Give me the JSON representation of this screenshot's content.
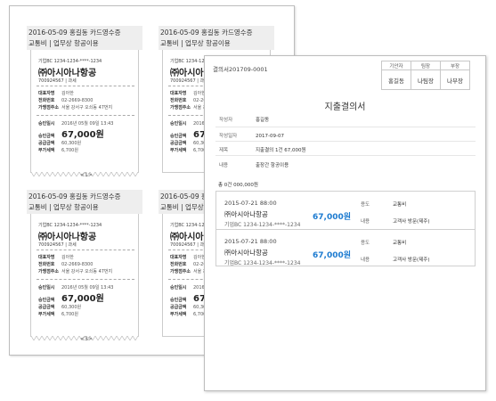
{
  "receipts": [
    {
      "title": "2016-05-09 홍길동 카드영수증",
      "subtitle": "교통비 | 업무상 항공이용",
      "card_no": "기업BC 1234-1234-****-1234",
      "merchant": "㈜아시아나항공",
      "biz_no": "700924567 | 과세",
      "rep_label": "대표자명",
      "rep_value": "김아한",
      "tel_label": "전화번호",
      "tel_value": "02-2669-8300",
      "addr_label": "가맹점주소",
      "addr_value": "서울 강서구 오쇠동 47번지",
      "date_label": "승인일시",
      "date_value": "2016년 05월 09일 13:43",
      "amount_label": "승인금액",
      "amount_value": "67,000원",
      "supply_label": "공급금액",
      "supply_value": "60,300원",
      "vat_label": "부가세액",
      "vat_value": "6,700원"
    },
    {
      "title": "2016-05-09 홍길동 카드영수증",
      "subtitle": "교통비 | 업무상 항공이용",
      "card_no": "기업BC 1234-1234-****-1234",
      "merchant": "㈜아시아나항공",
      "biz_no": "700924567 | 과세",
      "rep_label": "대표자명",
      "rep_value": "김아한",
      "tel_label": "전화번호",
      "tel_value": "02-2669-8300",
      "addr_label": "가맹점주소",
      "addr_value": "서울 강서구 오쇠동 47번지",
      "date_label": "승인일시",
      "date_value": "2016년 05월 09일 13:43",
      "amount_label": "승인금액",
      "amount_value": "67,000원",
      "supply_label": "공급금액",
      "supply_value": "60,300원",
      "vat_label": "부가세액",
      "vat_value": "6,700원"
    },
    {
      "title": "2016-05-09 홍길동 카드영수증",
      "subtitle": "교통비 | 업무상 항공이용",
      "card_no": "기업BC 1234-1234-****-1234",
      "merchant": "㈜아시아나항공",
      "biz_no": "700924567 | 과세",
      "rep_label": "대표자명",
      "rep_value": "김아한",
      "tel_label": "전화번호",
      "tel_value": "02-2669-8300",
      "addr_label": "가맹점주소",
      "addr_value": "서울 강서구 오쇠동 47번지",
      "date_label": "승인일시",
      "date_value": "2016년 05월 09일 13:43",
      "amount_label": "승인금액",
      "amount_value": "67,000원",
      "supply_label": "공급금액",
      "supply_value": "60,300원",
      "vat_label": "부가세액",
      "vat_value": "6,700원"
    },
    {
      "title": "2016-05-09 홍길동 카드영수증",
      "subtitle": "교통비 | 업무상 항공이용",
      "card_no": "기업BC 1234-1234-****-1234",
      "merchant": "㈜아시아나항공",
      "biz_no": "700924567 | 과세",
      "rep_label": "대표자명",
      "rep_value": "김아한",
      "tel_label": "전화번호",
      "tel_value": "02-2669-8300",
      "addr_label": "가맹점주소",
      "addr_value": "서울 강서구 오쇠동 47번지",
      "date_label": "승인일시",
      "date_value": "2016년 05월 09일 13:43",
      "amount_label": "승인금액",
      "amount_value": "67,000원",
      "supply_label": "공급금액",
      "supply_value": "60,300원",
      "vat_label": "부가세액",
      "vat_value": "6,700원"
    }
  ],
  "page_numbers": [
    "<1>",
    "<3>"
  ],
  "document": {
    "id": "결의서201709-0001",
    "approval_headers": [
      "기안자",
      "팀장",
      "부장"
    ],
    "approval_names": [
      "홍길동",
      "나팀장",
      "나부장"
    ],
    "title": "지출결의서",
    "info": [
      {
        "label": "작성자",
        "value": "홍길동"
      },
      {
        "label": "작성일자",
        "value": "2017-09-07"
      },
      {
        "label": "제목",
        "value": "지출결의 1건 67,000원"
      },
      {
        "label": "내용",
        "value": "출장간 항공이용"
      }
    ],
    "total": "총 0건 000,000원",
    "items": [
      {
        "date": "2015-07-21 88:00",
        "merchant": "㈜아시아나항공",
        "amount": "67,000원",
        "card": "기업BC 1234-1234-****-1234",
        "usage_label": "용도",
        "usage_value": "교통비",
        "content_label": "내용",
        "content_value": "고객사 방문(제주)"
      },
      {
        "date": "2015-07-21 88:00",
        "merchant": "㈜아시아나항공",
        "amount": "67,000원",
        "card": "기업BC 1234-1234-****-1234",
        "usage_label": "용도",
        "usage_value": "교통비",
        "content_label": "내용",
        "content_value": "고객사 방문(제주)"
      }
    ]
  },
  "colors": {
    "amount_blue": "#1d7bd0",
    "receipt_header_bg": "#eeeeee",
    "sheet_border": "#bdbdbd"
  }
}
